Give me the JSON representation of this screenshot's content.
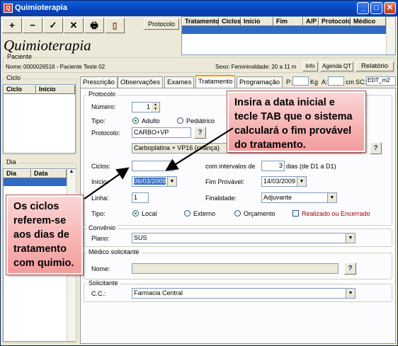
{
  "window": {
    "title": "Quimioterapia",
    "app_icon": "app-icon",
    "minimize": "_",
    "maximize": "□",
    "close": "✕"
  },
  "toolbar": {
    "add": "+",
    "remove": "−",
    "confirm": "✓",
    "cancel": "✕",
    "print_icon": "printer-icon",
    "exit_icon": "exit-door-icon",
    "protocolo_btn": "Protocolo"
  },
  "top_grid": {
    "columns": [
      "Tratamento",
      "Ciclos",
      "Início",
      "Fim",
      "A/P",
      "Protocolo",
      "Médico"
    ]
  },
  "app_heading": "Quimioterapia",
  "paciente": {
    "legend": "Paciente",
    "nome_label": "Nome:",
    "nome_value": "0000026516 - Paciente Teste 02",
    "sexo": "Sexo: Feminino",
    "idade": "Idade: 20 a 11 m",
    "info_btn": "Info",
    "agenda_btn": "Agenda QT",
    "relatorio_btn": "Relatório"
  },
  "ciclo_panel": {
    "legend": "Ciclo",
    "columns": [
      "Ciclo",
      "Início"
    ]
  },
  "dia_panel": {
    "legend": "Dia",
    "columns": [
      "Dia",
      "Data"
    ]
  },
  "tabs": [
    "Prescrição",
    "Observações",
    "Exames",
    "Tratamento",
    "Programação"
  ],
  "tabs_extra": {
    "p_label": "P:",
    "kg_label": "Kg",
    "a_label": "A:",
    "cm_label": "cm",
    "sc_label": "SC:",
    "sc_value": "EDT_m2"
  },
  "protocolo": {
    "legend": "Protocolo",
    "numero_label": "Número:",
    "numero_value": "1",
    "tipo_label": "Tipo:",
    "tipo_adulto": "Adulto",
    "tipo_pediatrico": "Pediátrico",
    "protocolo_label": "Protocolo:",
    "protocolo_value": "CARBO+VP",
    "protocolo_desc": "Carboplatina + VP16 (criança)",
    "help": "?"
  },
  "tratamento": {
    "ciclos_label": "Ciclos:",
    "ciclos_value": "3",
    "intervalos_label": "com intervalos de",
    "intervalos_value": "3",
    "intervalos_suffix": "dias (de D1 a D1)",
    "inicio_label": "Início:",
    "inicio_value": "06/03/2009",
    "fim_label": "Fim Provável:",
    "fim_value": "14/03/2009",
    "linha_label": "Linha:",
    "linha_value": "1",
    "finalidade_label": "Finalidade:",
    "finalidade_value": "Adjuvante",
    "tipo_label": "Tipo:",
    "tipo_local": "Local",
    "tipo_externo": "Externo",
    "tipo_orcamento": "Orçamento",
    "realizado_label": "Realizado ou Encerrado"
  },
  "convenio": {
    "legend": "Convênio",
    "plano_label": "Plano:",
    "plano_value": "SUS"
  },
  "medico": {
    "legend": "Médico solicitante",
    "nome_label": "Nome:",
    "help": "?"
  },
  "solicitante": {
    "legend": "Solicitante",
    "cc_label": "C.C.:",
    "cc_value": "Farmacia Central"
  },
  "notes": {
    "top": "Insira a data  inicial e tecle TAB que o sistema calculará o fim provável do tratamento.",
    "left": "Os ciclos referem-se aos dias de tratamento com quimio."
  },
  "colors": {
    "accent": "#0a5fdc",
    "note_bg": "#f5a9a9",
    "realizado": "#a00000"
  }
}
